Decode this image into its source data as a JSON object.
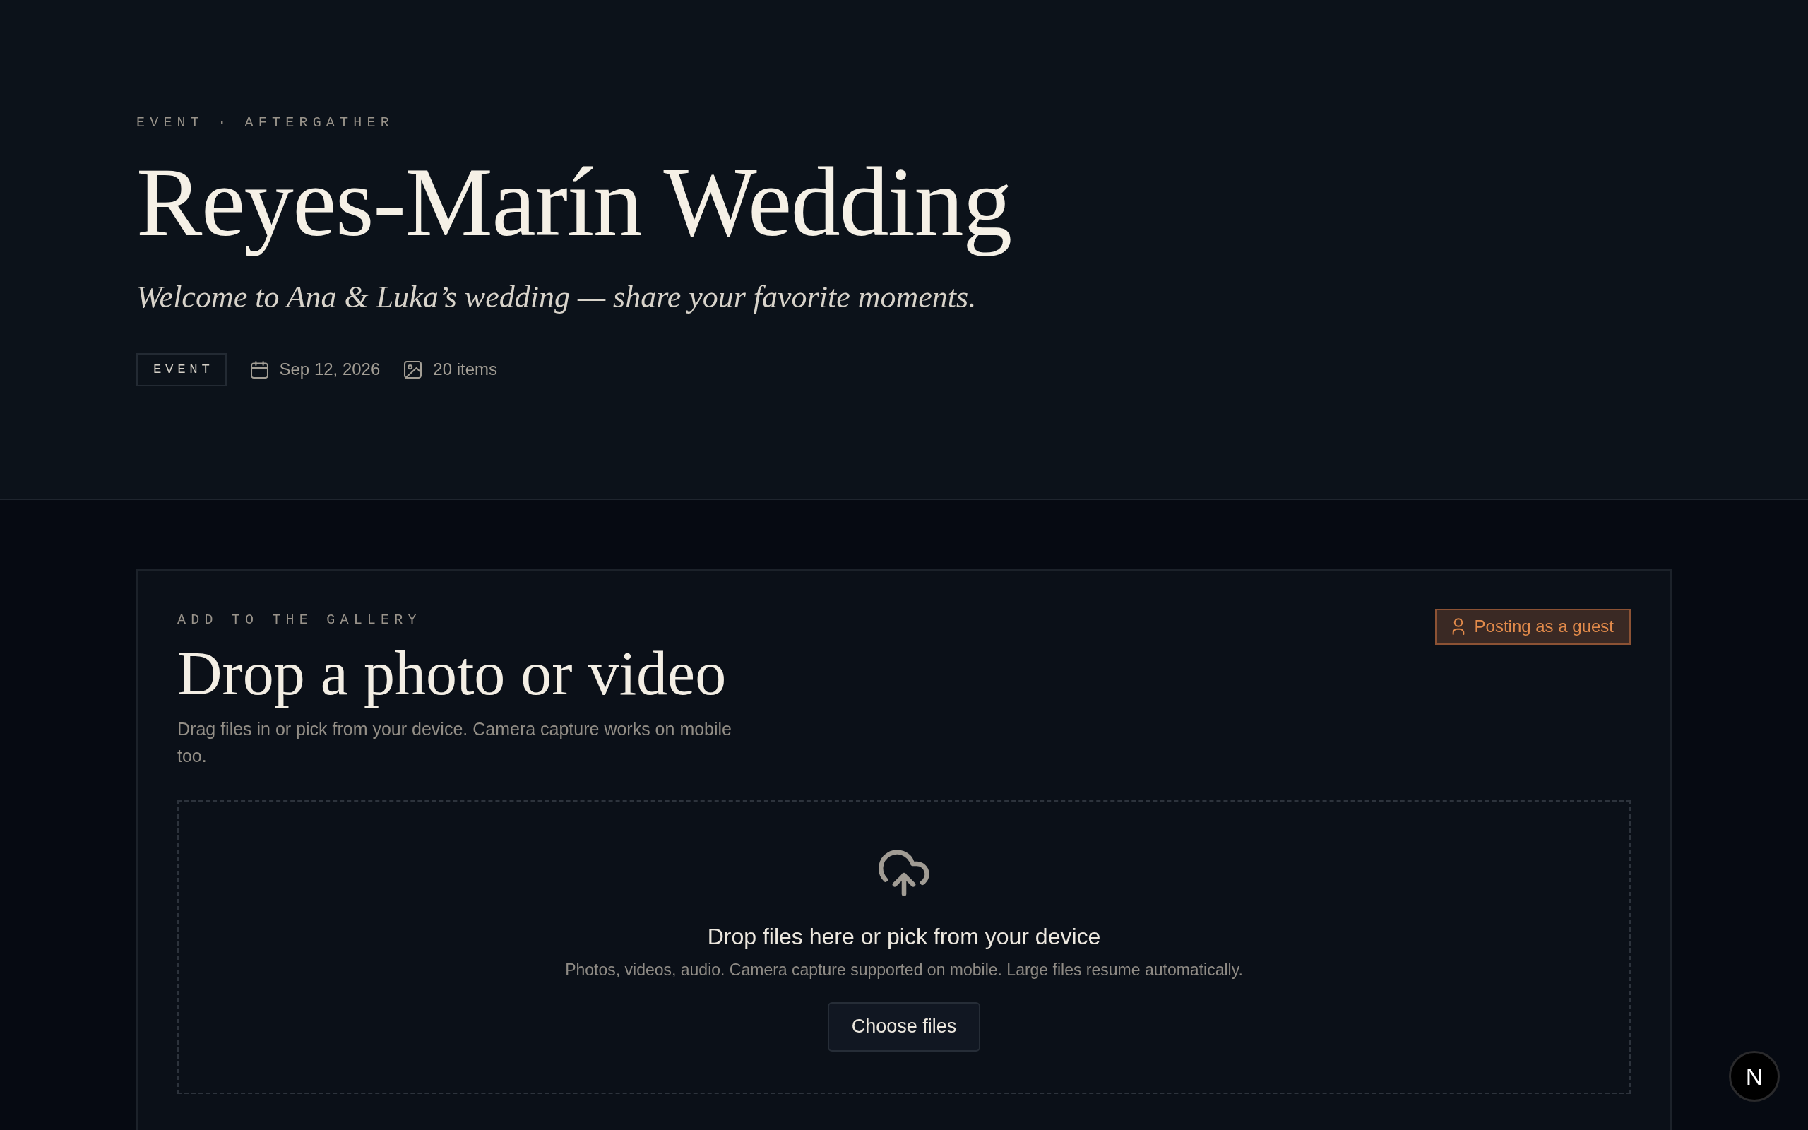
{
  "header": {
    "eyebrow": "EVENT · AFTERGATHER",
    "title": "Reyes-Marín Wedding",
    "tagline": "Welcome to Ana & Luka’s wedding — share your favorite moments.",
    "meta": [
      {
        "kind": "tag",
        "text": "EVENT"
      },
      {
        "kind": "date",
        "text": "Sep 12, 2026"
      },
      {
        "kind": "count",
        "text": "20 items"
      }
    ]
  },
  "upload_card": {
    "eyebrow": "ADD TO THE GALLERY",
    "title": "Drop a photo or video",
    "description": "Drag files in or pick from your device. Camera capture works on mobile too.",
    "guest_badge": "Posting as a guest",
    "dropzone": {
      "title": "Drop files here or pick from your device",
      "hint": "Photos, videos, audio. Camera capture supported on mobile. Large files resume automatically.",
      "button": "Choose files"
    }
  },
  "corner_button": {
    "label": "N"
  }
}
